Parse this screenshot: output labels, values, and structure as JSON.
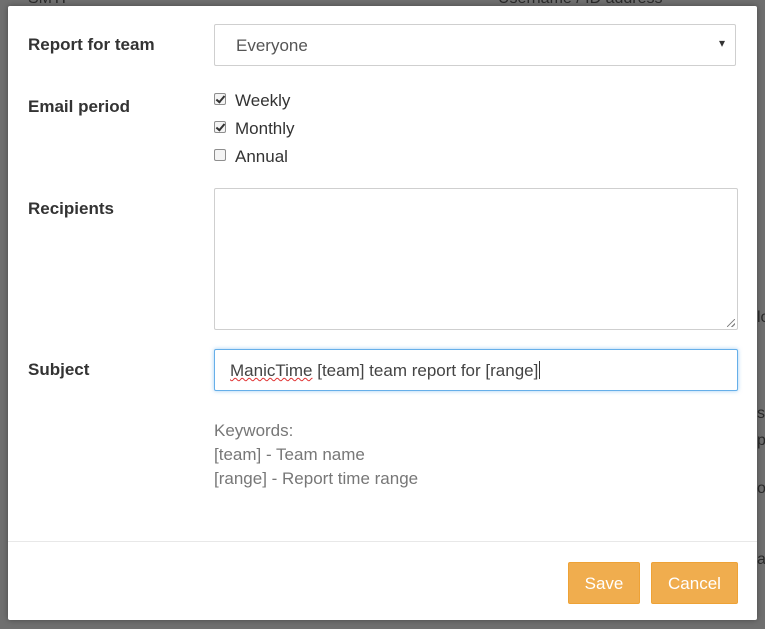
{
  "background": {
    "partial_text": [
      "SMTP",
      "Username / ID address",
      "lo",
      "s",
      "p",
      "o",
      "a"
    ]
  },
  "form": {
    "report_for_team": {
      "label": "Report for team",
      "selected": "Everyone",
      "caret": "▾"
    },
    "email_period": {
      "label": "Email period",
      "options": [
        {
          "label": "Weekly",
          "checked": true
        },
        {
          "label": "Monthly",
          "checked": true
        },
        {
          "label": "Annual",
          "checked": false
        }
      ]
    },
    "recipients": {
      "label": "Recipients",
      "value": ""
    },
    "subject": {
      "label": "Subject",
      "value_word1": "ManicTime",
      "value_rest": " [team] team report for [range]"
    },
    "keywords": {
      "title": "Keywords:",
      "items": [
        "[team] - Team name",
        "[range] - Report time range"
      ]
    }
  },
  "footer": {
    "save_label": "Save",
    "cancel_label": "Cancel"
  },
  "colors": {
    "accent": "#f0ad4e",
    "focus_border": "#66afe9",
    "text": "#333333",
    "muted": "#777777"
  }
}
